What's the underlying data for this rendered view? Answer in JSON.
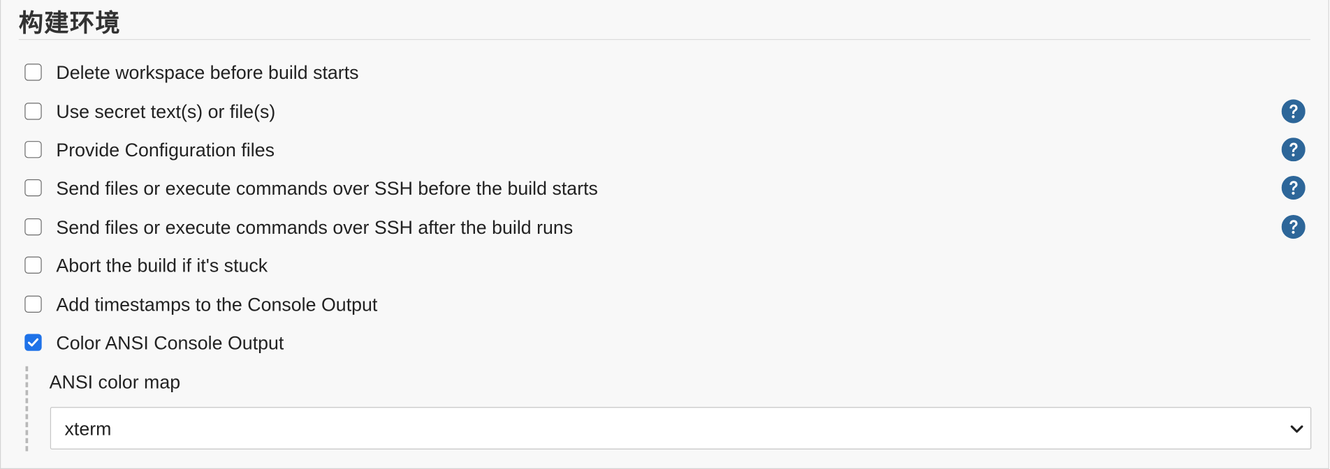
{
  "section": {
    "title": "构建环境"
  },
  "options": [
    {
      "label": "Delete workspace before build starts",
      "checked": false,
      "help": false
    },
    {
      "label": "Use secret text(s) or file(s)",
      "checked": false,
      "help": true
    },
    {
      "label": "Provide Configuration files",
      "checked": false,
      "help": true
    },
    {
      "label": "Send files or execute commands over SSH before the build starts",
      "checked": false,
      "help": true
    },
    {
      "label": "Send files or execute commands over SSH after the build runs",
      "checked": false,
      "help": true
    },
    {
      "label": "Abort the build if it's stuck",
      "checked": false,
      "help": false
    },
    {
      "label": "Add timestamps to the Console Output",
      "checked": false,
      "help": false
    },
    {
      "label": "Color ANSI Console Output",
      "checked": true,
      "help": false
    }
  ],
  "ansi": {
    "label": "ANSI color map",
    "selected": "xterm"
  },
  "icons": {
    "help": "question-circle-icon",
    "check": "checkmark-icon",
    "dropdown": "chevron-down-icon"
  },
  "colors": {
    "accent": "#1e72e8",
    "help": "#2d6699",
    "background": "#f8f8f8"
  }
}
